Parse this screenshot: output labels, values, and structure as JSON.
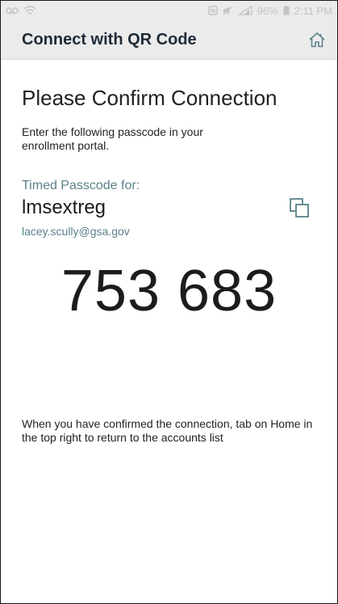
{
  "status_bar": {
    "left_icons": [
      "voicemail-icon",
      "wifi-icon"
    ],
    "right_icons": [
      "nfc-icon",
      "mute-icon",
      "signal-icon"
    ],
    "battery": "96%",
    "time": "2:11 PM"
  },
  "app_bar": {
    "title": "Connect with QR Code",
    "home_icon": "home-icon"
  },
  "main": {
    "heading": "Please Confirm Connection",
    "instruction": "Enter the following passcode in your enrollment portal.",
    "passcode_label": "Timed Passcode for:",
    "account_name": "lmsextreg",
    "account_email": "lacey.scully@gsa.gov",
    "copy_icon": "copy-icon",
    "passcode": "753 683",
    "footer_note": "When you have confirmed the connection, tab on Home in the top right to return to the accounts list"
  },
  "colors": {
    "status_bar_bg": "#ebebeb",
    "app_bar_bg": "#ebebeb",
    "accent_teal": "#5a8288",
    "icon_color": "#5a8288"
  }
}
